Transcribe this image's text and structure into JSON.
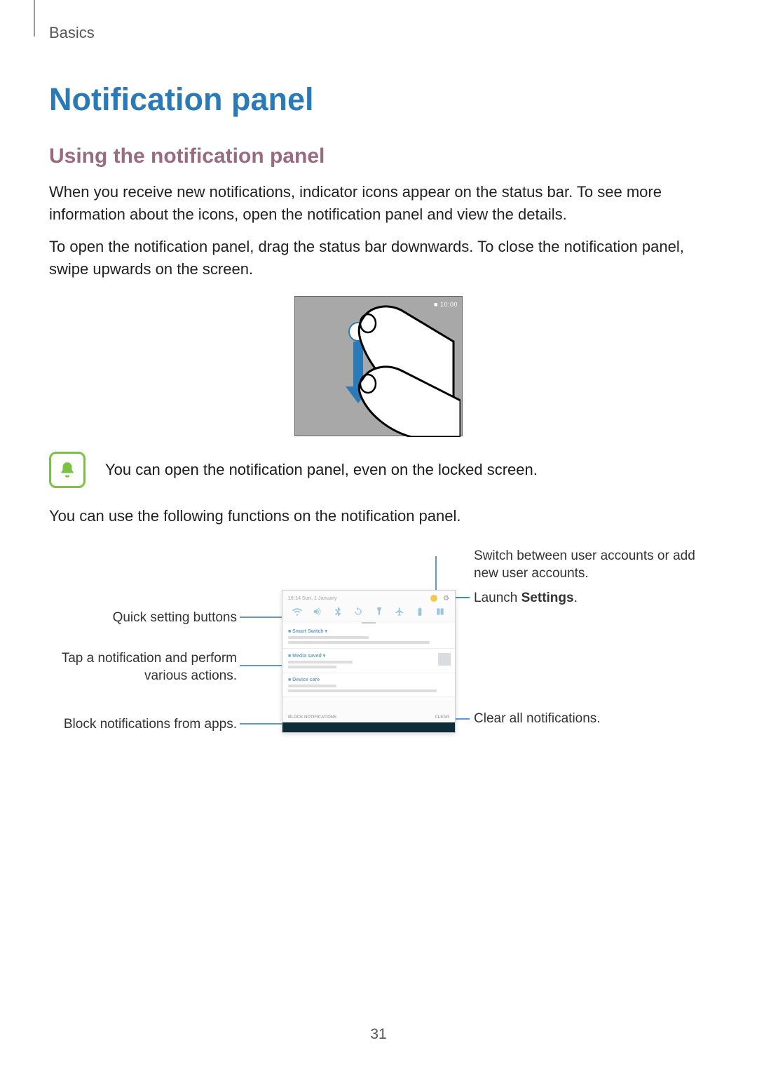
{
  "section_label": "Basics",
  "h1": "Notification panel",
  "h2": "Using the notification panel",
  "p1": "When you receive new notifications, indicator icons appear on the status bar. To see more information about the icons, open the notification panel and view the details.",
  "p2": "To open the notification panel, drag the status bar downwards. To close the notification panel, swipe upwards on the screen.",
  "status_clock": "10:00",
  "note": "You can open the notification panel, even on the locked screen.",
  "p3": "You can use the following functions on the notification panel.",
  "callouts": {
    "quick_settings": "Quick setting buttons",
    "tap_notification": "Tap a notification and perform various actions.",
    "block_notifications": "Block notifications from apps.",
    "switch_users": "Switch between user accounts or add new user accounts.",
    "launch_settings_pre": "Launch ",
    "launch_settings_bold": "Settings",
    "launch_settings_post": ".",
    "clear_all": "Clear all notifications."
  },
  "panel": {
    "date": "10:14   Sun, 1 January",
    "block_label": "BLOCK NOTIFICATIONS",
    "clear_label": "CLEAR"
  },
  "page_number": "31"
}
